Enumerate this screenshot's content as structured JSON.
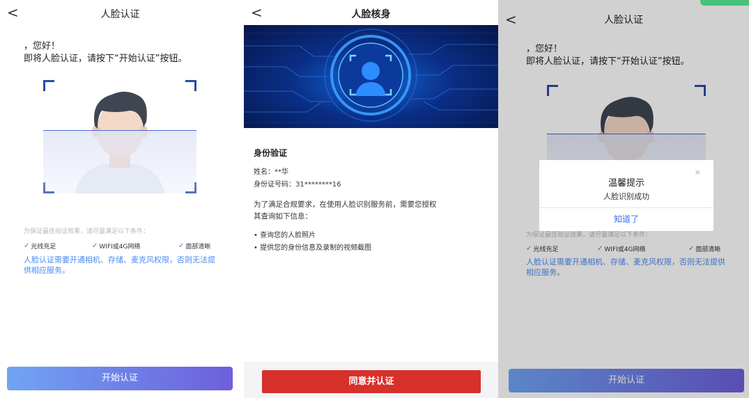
{
  "panel1": {
    "nav_title": "人脸认证",
    "back": "<",
    "greeting": "，您好！",
    "instruction": "即将人脸认证，请按下“开始认证”按钮。",
    "hint": "为保证最佳验证效果，请尽量满足以下条件：",
    "conditions": [
      "光线充足",
      "WIFI或4G网络",
      "面部清晰"
    ],
    "permission_note": "人脸认证需要开通相机、存储、麦克风权限，否则无法提供相应服务。",
    "start_button": "开始认证"
  },
  "panel2": {
    "nav_title": "人脸核身",
    "back": "<",
    "section_title": "身份验证",
    "name_line": "姓名：**华",
    "id_line": "身份证号码：31********16",
    "notice_1": "为了满足合规要求，在使用人脸识别服务前，需要您授权",
    "notice_2": "其查询如下信息：",
    "bullets": [
      "查询您的人脸照片",
      "提供您的身份信息及录制的视频截图"
    ],
    "agree_button": "同意并认证"
  },
  "panel3": {
    "nav_title": "人脸认证",
    "back": "<",
    "greeting": "，您好！",
    "instruction": "即将人脸认证，请按下“开始认证”按钮。",
    "hint": "为保证最佳验证效果，请尽量满足以下条件：",
    "conditions": [
      "光线充足",
      "WIFI或4G网络",
      "面部清晰"
    ],
    "permission_note": "人脸认证需要开通相机、存储、麦克风权限，否则无法提供相应服务。",
    "start_button": "开始认证",
    "dialog": {
      "title": "温馨提示",
      "message": "人脸识别成功",
      "confirm": "知道了",
      "close": "×"
    }
  },
  "colors": {
    "accent_blue": "#4a8af0",
    "button_gradient_start": "#70a4f4",
    "button_gradient_end": "#6d5fdc",
    "agree_red": "#d8302b",
    "dialog_link": "#3c6fe0"
  },
  "icons": [
    "back-arrow-icon",
    "checkmark-icon",
    "face-scan-icon",
    "close-icon"
  ]
}
